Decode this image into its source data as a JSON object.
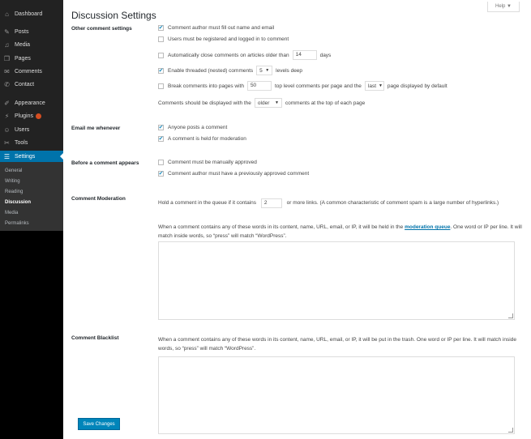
{
  "sidebar": {
    "items": [
      {
        "label": "Dashboard",
        "icon": "dashboard-icon",
        "glyph": "⌂"
      },
      {
        "label": "Posts",
        "icon": "pin-icon",
        "glyph": "✎"
      },
      {
        "label": "Media",
        "icon": "media-icon",
        "glyph": "♫"
      },
      {
        "label": "Pages",
        "icon": "pages-icon",
        "glyph": "❒"
      },
      {
        "label": "Comments",
        "icon": "comments-icon",
        "glyph": "✉"
      },
      {
        "label": "Contact",
        "icon": "contact-icon",
        "glyph": "✆"
      },
      {
        "label": "Appearance",
        "icon": "appearance-icon",
        "glyph": "✐"
      },
      {
        "label": "Plugins",
        "icon": "plugins-icon",
        "glyph": "⚡"
      },
      {
        "label": "Users",
        "icon": "users-icon",
        "glyph": "☺"
      },
      {
        "label": "Tools",
        "icon": "tools-icon",
        "glyph": "✂"
      },
      {
        "label": "Settings",
        "icon": "settings-icon",
        "glyph": "☰"
      }
    ],
    "submenu": [
      "General",
      "Writing",
      "Reading",
      "Discussion",
      "Media",
      "Permalinks"
    ]
  },
  "help_label": "Help ▼",
  "page_title": "Discussion Settings",
  "sections": {
    "other": {
      "label": "Other comment settings",
      "require_name_email": "Comment author must fill out name and email",
      "registered_only": "Users must be registered and logged in to comment",
      "close_prefix": "Automatically close comments on articles older than",
      "close_days": "14",
      "close_suffix": "days",
      "threaded_prefix": "Enable threaded (nested) comments",
      "threaded_depth": "5",
      "threaded_suffix": "levels deep",
      "paged_prefix": "Break comments into pages with",
      "paged_count": "50",
      "paged_mid": "top level comments per page and the",
      "paged_page": "last",
      "paged_suffix": "page displayed by default",
      "order_prefix": "Comments should be displayed with the",
      "order_value": "older",
      "order_suffix": "comments at the top of each page"
    },
    "email": {
      "label": "Email me whenever",
      "anyone_posts": "Anyone posts a comment",
      "held_moderation": "A comment is held for moderation"
    },
    "before": {
      "label": "Before a comment appears",
      "manual": "Comment must be manually approved",
      "previously": "Comment author must have a previously approved comment"
    },
    "moderation": {
      "label": "Comment Moderation",
      "hold_prefix": "Hold a comment in the queue if it contains",
      "hold_links": "2",
      "hold_suffix": "or more links. (A common characteristic of comment spam is a large number of hyperlinks.)",
      "desc_prefix": "When a comment contains any of these words in its content, name, URL, email, or IP, it will be held in the",
      "desc_link": "moderation queue",
      "desc_suffix": ". One word or IP per line. It will match inside words, so “press” will match “WordPress”."
    },
    "blacklist": {
      "label": "Comment Blacklist",
      "desc": "When a comment contains any of these words in its content, name, URL, email, or IP, it will be put in the trash. One word or IP per line. It will match inside words, so “press” will match “WordPress”."
    }
  },
  "save_label": "Save Changes"
}
